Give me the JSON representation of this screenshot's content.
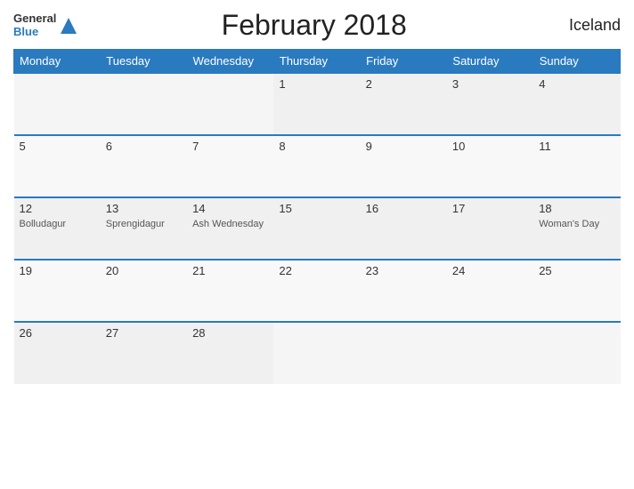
{
  "header": {
    "title": "February 2018",
    "country": "Iceland",
    "logo_general": "General",
    "logo_blue": "Blue"
  },
  "weekdays": [
    "Monday",
    "Tuesday",
    "Wednesday",
    "Thursday",
    "Friday",
    "Saturday",
    "Sunday"
  ],
  "weeks": [
    [
      {
        "day": "",
        "event": ""
      },
      {
        "day": "",
        "event": ""
      },
      {
        "day": "",
        "event": ""
      },
      {
        "day": "1",
        "event": ""
      },
      {
        "day": "2",
        "event": ""
      },
      {
        "day": "3",
        "event": ""
      },
      {
        "day": "4",
        "event": ""
      }
    ],
    [
      {
        "day": "5",
        "event": ""
      },
      {
        "day": "6",
        "event": ""
      },
      {
        "day": "7",
        "event": ""
      },
      {
        "day": "8",
        "event": ""
      },
      {
        "day": "9",
        "event": ""
      },
      {
        "day": "10",
        "event": ""
      },
      {
        "day": "11",
        "event": ""
      }
    ],
    [
      {
        "day": "12",
        "event": "Bolludagur"
      },
      {
        "day": "13",
        "event": "Sprengidagur"
      },
      {
        "day": "14",
        "event": "Ash Wednesday"
      },
      {
        "day": "15",
        "event": ""
      },
      {
        "day": "16",
        "event": ""
      },
      {
        "day": "17",
        "event": ""
      },
      {
        "day": "18",
        "event": "Woman's Day"
      }
    ],
    [
      {
        "day": "19",
        "event": ""
      },
      {
        "day": "20",
        "event": ""
      },
      {
        "day": "21",
        "event": ""
      },
      {
        "day": "22",
        "event": ""
      },
      {
        "day": "23",
        "event": ""
      },
      {
        "day": "24",
        "event": ""
      },
      {
        "day": "25",
        "event": ""
      }
    ],
    [
      {
        "day": "26",
        "event": ""
      },
      {
        "day": "27",
        "event": ""
      },
      {
        "day": "28",
        "event": ""
      },
      {
        "day": "",
        "event": ""
      },
      {
        "day": "",
        "event": ""
      },
      {
        "day": "",
        "event": ""
      },
      {
        "day": "",
        "event": ""
      }
    ]
  ]
}
